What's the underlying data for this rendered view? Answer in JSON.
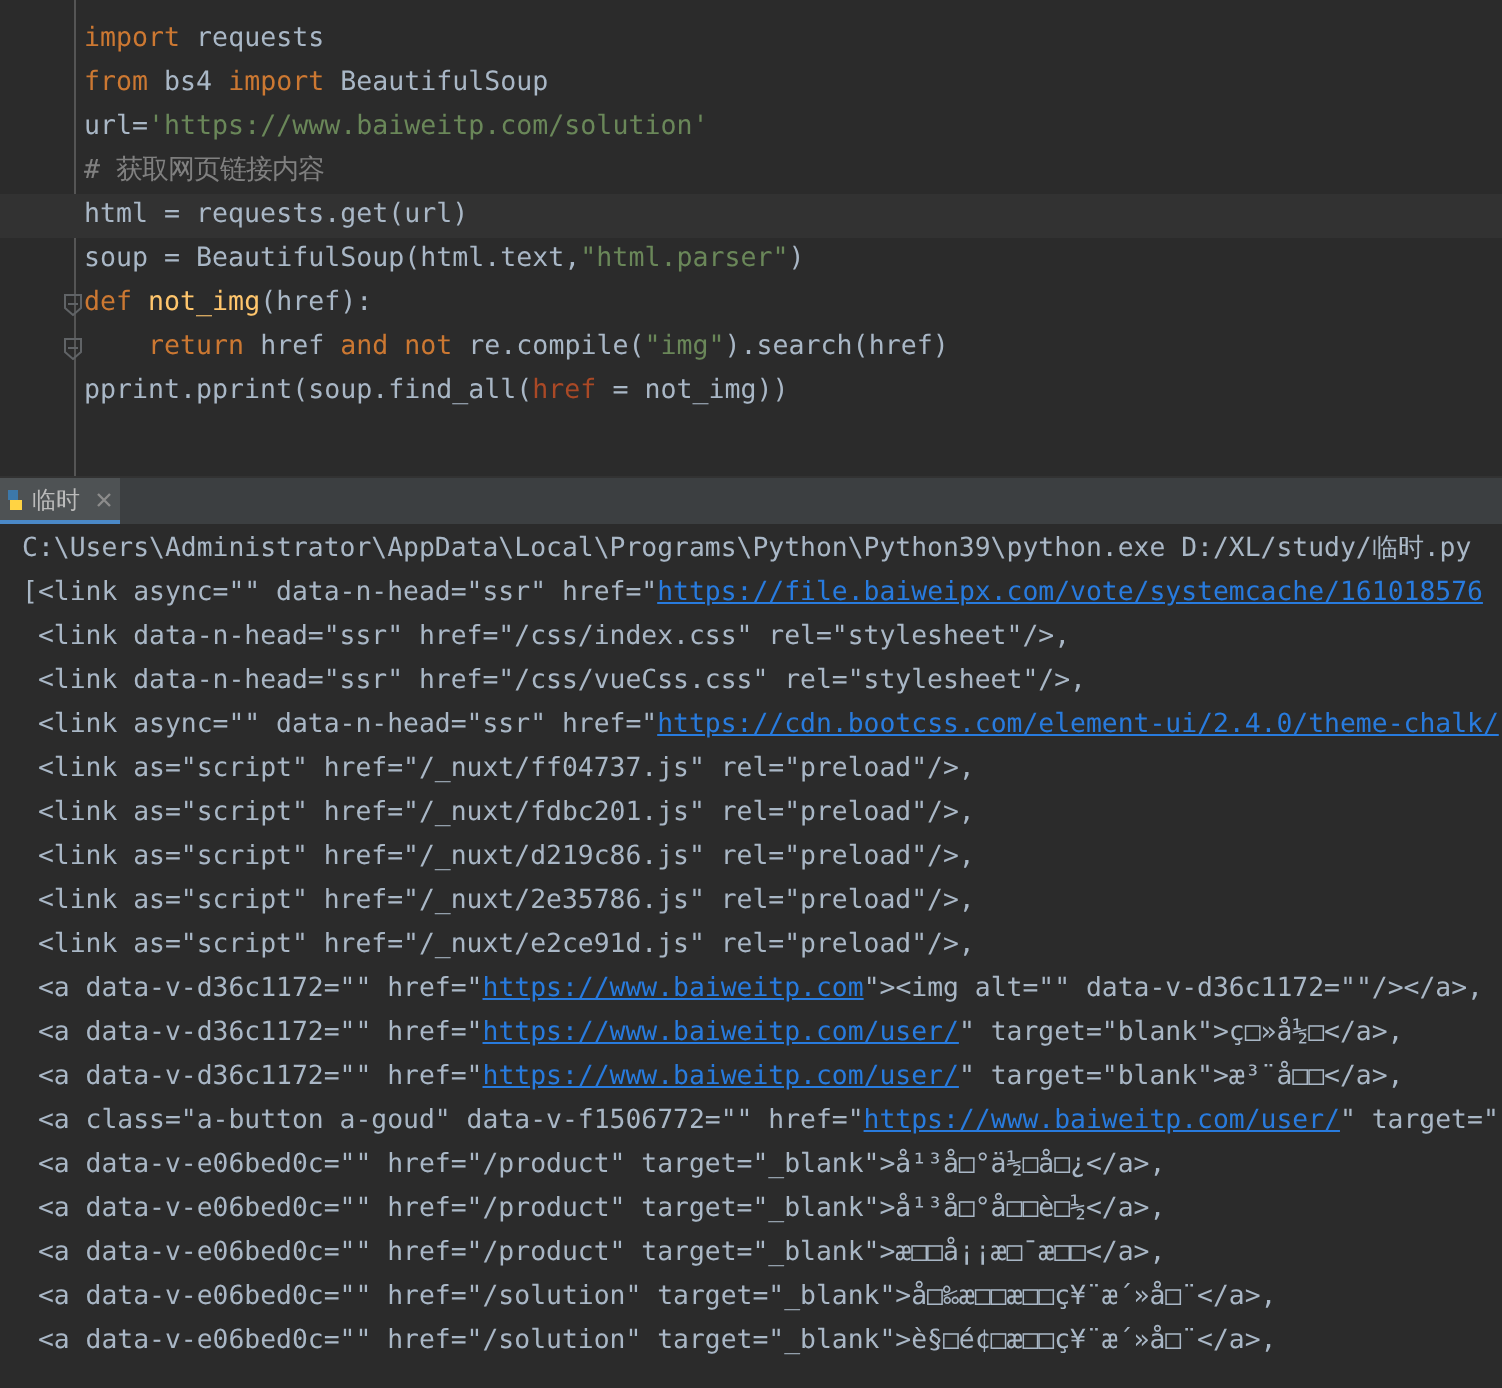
{
  "editor": {
    "lines": [
      {
        "tokens": [
          {
            "kind": "keyword",
            "text": "import"
          },
          {
            "kind": "plain",
            "text": " requests"
          }
        ]
      },
      {
        "tokens": [
          {
            "kind": "keyword",
            "text": "from"
          },
          {
            "kind": "plain",
            "text": " bs4 "
          },
          {
            "kind": "keyword",
            "text": "import"
          },
          {
            "kind": "plain",
            "text": " BeautifulSoup"
          }
        ]
      },
      {
        "tokens": [
          {
            "kind": "plain",
            "text": "url="
          },
          {
            "kind": "string",
            "text": "'https://www.baiweitp.com/solution'"
          }
        ]
      },
      {
        "tokens": [
          {
            "kind": "comment",
            "text": "# 获取网页链接内容"
          }
        ]
      },
      {
        "current": true,
        "tokens": [
          {
            "kind": "plain",
            "text": "html = requests.get(url)"
          }
        ]
      },
      {
        "tokens": [
          {
            "kind": "plain",
            "text": "soup = BeautifulSoup(html.text,"
          },
          {
            "kind": "string",
            "text": "\"html.parser\""
          },
          {
            "kind": "plain",
            "text": ")"
          }
        ]
      },
      {
        "fold": true,
        "tokens": [
          {
            "kind": "keyword",
            "text": "def "
          },
          {
            "kind": "function",
            "text": "not_img"
          },
          {
            "kind": "plain",
            "text": "(href):"
          }
        ]
      },
      {
        "fold": true,
        "tokens": [
          {
            "kind": "keyword",
            "text": "    return"
          },
          {
            "kind": "plain",
            "text": " href "
          },
          {
            "kind": "keyword",
            "text": "and not"
          },
          {
            "kind": "plain",
            "text": " re.compile("
          },
          {
            "kind": "string",
            "text": "\"img\""
          },
          {
            "kind": "plain",
            "text": ").search(href)"
          }
        ]
      },
      {
        "tokens": [
          {
            "kind": "plain",
            "text": "pprint.pprint(soup.find_all("
          },
          {
            "kind": "param",
            "text": "href"
          },
          {
            "kind": "plain",
            "text": " = not_img))"
          }
        ]
      }
    ]
  },
  "run_panel": {
    "tabs": [
      {
        "label": "临时",
        "selected": true
      }
    ]
  },
  "console": {
    "lines": [
      {
        "segments": [
          {
            "kind": "text",
            "text": "C:\\Users\\Administrator\\AppData\\Local\\Programs\\Python\\Python39\\python.exe D:/XL/study/临时.py"
          }
        ]
      },
      {
        "segments": [
          {
            "kind": "text",
            "text": "[<link async=\"\" data-n-head=\"ssr\" href=\""
          },
          {
            "kind": "link",
            "text": "https://file.baiweipx.com/vote/systemcache/161018576"
          }
        ]
      },
      {
        "segments": [
          {
            "kind": "text",
            "text": " <link data-n-head=\"ssr\" href=\"/css/index.css\" rel=\"stylesheet\"/>,"
          }
        ]
      },
      {
        "segments": [
          {
            "kind": "text",
            "text": " <link data-n-head=\"ssr\" href=\"/css/vueCss.css\" rel=\"stylesheet\"/>,"
          }
        ]
      },
      {
        "segments": [
          {
            "kind": "text",
            "text": " <link async=\"\" data-n-head=\"ssr\" href=\""
          },
          {
            "kind": "link",
            "text": "https://cdn.bootcss.com/element-ui/2.4.0/theme-chalk/"
          }
        ]
      },
      {
        "segments": [
          {
            "kind": "text",
            "text": " <link as=\"script\" href=\"/_nuxt/ff04737.js\" rel=\"preload\"/>,"
          }
        ]
      },
      {
        "segments": [
          {
            "kind": "text",
            "text": " <link as=\"script\" href=\"/_nuxt/fdbc201.js\" rel=\"preload\"/>,"
          }
        ]
      },
      {
        "segments": [
          {
            "kind": "text",
            "text": " <link as=\"script\" href=\"/_nuxt/d219c86.js\" rel=\"preload\"/>,"
          }
        ]
      },
      {
        "segments": [
          {
            "kind": "text",
            "text": " <link as=\"script\" href=\"/_nuxt/2e35786.js\" rel=\"preload\"/>,"
          }
        ]
      },
      {
        "segments": [
          {
            "kind": "text",
            "text": " <link as=\"script\" href=\"/_nuxt/e2ce91d.js\" rel=\"preload\"/>,"
          }
        ]
      },
      {
        "segments": [
          {
            "kind": "text",
            "text": " <a data-v-d36c1172=\"\" href=\""
          },
          {
            "kind": "link",
            "text": "https://www.baiweitp.com"
          },
          {
            "kind": "text",
            "text": "\"><img alt=\"\" data-v-d36c1172=\"\"/></a>,"
          }
        ]
      },
      {
        "segments": [
          {
            "kind": "text",
            "text": " <a data-v-d36c1172=\"\" href=\""
          },
          {
            "kind": "link",
            "text": "https://www.baiweitp.com/user/"
          },
          {
            "kind": "text",
            "text": "\" target=\"blank\">ç□»å½□</a>,"
          }
        ]
      },
      {
        "segments": [
          {
            "kind": "text",
            "text": " <a data-v-d36c1172=\"\" href=\""
          },
          {
            "kind": "link",
            "text": "https://www.baiweitp.com/user/"
          },
          {
            "kind": "text",
            "text": "\" target=\"blank\">æ³¨å□□</a>,"
          }
        ]
      },
      {
        "segments": [
          {
            "kind": "text",
            "text": " <a class=\"a-button a-goud\" data-v-f1506772=\"\" href=\""
          },
          {
            "kind": "link",
            "text": "https://www.baiweitp.com/user/"
          },
          {
            "kind": "text",
            "text": "\" target=\""
          }
        ]
      },
      {
        "segments": [
          {
            "kind": "text",
            "text": " <a data-v-e06bed0c=\"\" href=\"/product\" target=\"_blank\">å¹³å□°ä½□å□¿</a>,"
          }
        ]
      },
      {
        "segments": [
          {
            "kind": "text",
            "text": " <a data-v-e06bed0c=\"\" href=\"/product\" target=\"_blank\">å¹³å□°å□□è□½</a>,"
          }
        ]
      },
      {
        "segments": [
          {
            "kind": "text",
            "text": " <a data-v-e06bed0c=\"\" href=\"/product\" target=\"_blank\">æ□□å¡¡æ□¯æ□□</a>,"
          }
        ]
      },
      {
        "segments": [
          {
            "kind": "text",
            "text": " <a data-v-e06bed0c=\"\" href=\"/solution\" target=\"_blank\">å□‰æ□□æ□□ç¥¨æ´»å□¨</a>,"
          }
        ]
      },
      {
        "segments": [
          {
            "kind": "text",
            "text": " <a data-v-e06bed0c=\"\" href=\"/solution\" target=\"_blank\">è§□é¢□æ□□ç¥¨æ´»å□¨</a>,"
          }
        ]
      }
    ]
  }
}
